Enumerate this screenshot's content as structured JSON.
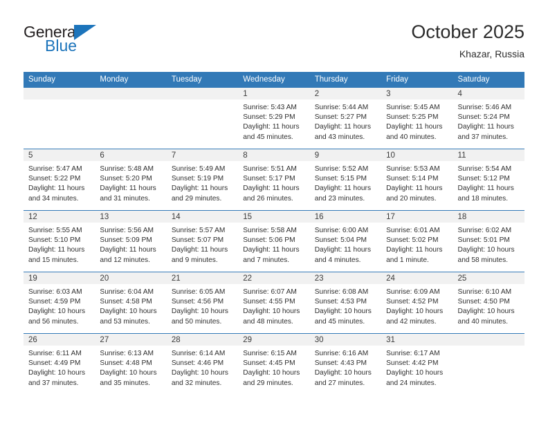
{
  "brand": {
    "name_top": "General",
    "name_bottom": "Blue",
    "triangle_icon": "blue-triangle-icon",
    "color_dark": "#231f20",
    "color_blue": "#1c74bb"
  },
  "header": {
    "title": "October 2025",
    "subtitle": "Khazar, Russia"
  },
  "theme": {
    "header_blue": "#3279b7",
    "daynum_band": "#f1f1f1",
    "text": "#2e2e2e"
  },
  "weekdays": [
    "Sunday",
    "Monday",
    "Tuesday",
    "Wednesday",
    "Thursday",
    "Friday",
    "Saturday"
  ],
  "weeks": [
    [
      {
        "day": "",
        "empty": true,
        "lines": []
      },
      {
        "day": "",
        "empty": true,
        "lines": []
      },
      {
        "day": "",
        "empty": true,
        "lines": []
      },
      {
        "day": "1",
        "empty": false,
        "lines": [
          "Sunrise: 5:43 AM",
          "Sunset: 5:29 PM",
          "Daylight: 11 hours",
          "and 45 minutes."
        ]
      },
      {
        "day": "2",
        "empty": false,
        "lines": [
          "Sunrise: 5:44 AM",
          "Sunset: 5:27 PM",
          "Daylight: 11 hours",
          "and 43 minutes."
        ]
      },
      {
        "day": "3",
        "empty": false,
        "lines": [
          "Sunrise: 5:45 AM",
          "Sunset: 5:25 PM",
          "Daylight: 11 hours",
          "and 40 minutes."
        ]
      },
      {
        "day": "4",
        "empty": false,
        "lines": [
          "Sunrise: 5:46 AM",
          "Sunset: 5:24 PM",
          "Daylight: 11 hours",
          "and 37 minutes."
        ]
      }
    ],
    [
      {
        "day": "5",
        "empty": false,
        "lines": [
          "Sunrise: 5:47 AM",
          "Sunset: 5:22 PM",
          "Daylight: 11 hours",
          "and 34 minutes."
        ]
      },
      {
        "day": "6",
        "empty": false,
        "lines": [
          "Sunrise: 5:48 AM",
          "Sunset: 5:20 PM",
          "Daylight: 11 hours",
          "and 31 minutes."
        ]
      },
      {
        "day": "7",
        "empty": false,
        "lines": [
          "Sunrise: 5:49 AM",
          "Sunset: 5:19 PM",
          "Daylight: 11 hours",
          "and 29 minutes."
        ]
      },
      {
        "day": "8",
        "empty": false,
        "lines": [
          "Sunrise: 5:51 AM",
          "Sunset: 5:17 PM",
          "Daylight: 11 hours",
          "and 26 minutes."
        ]
      },
      {
        "day": "9",
        "empty": false,
        "lines": [
          "Sunrise: 5:52 AM",
          "Sunset: 5:15 PM",
          "Daylight: 11 hours",
          "and 23 minutes."
        ]
      },
      {
        "day": "10",
        "empty": false,
        "lines": [
          "Sunrise: 5:53 AM",
          "Sunset: 5:14 PM",
          "Daylight: 11 hours",
          "and 20 minutes."
        ]
      },
      {
        "day": "11",
        "empty": false,
        "lines": [
          "Sunrise: 5:54 AM",
          "Sunset: 5:12 PM",
          "Daylight: 11 hours",
          "and 18 minutes."
        ]
      }
    ],
    [
      {
        "day": "12",
        "empty": false,
        "lines": [
          "Sunrise: 5:55 AM",
          "Sunset: 5:10 PM",
          "Daylight: 11 hours",
          "and 15 minutes."
        ]
      },
      {
        "day": "13",
        "empty": false,
        "lines": [
          "Sunrise: 5:56 AM",
          "Sunset: 5:09 PM",
          "Daylight: 11 hours",
          "and 12 minutes."
        ]
      },
      {
        "day": "14",
        "empty": false,
        "lines": [
          "Sunrise: 5:57 AM",
          "Sunset: 5:07 PM",
          "Daylight: 11 hours",
          "and 9 minutes."
        ]
      },
      {
        "day": "15",
        "empty": false,
        "lines": [
          "Sunrise: 5:58 AM",
          "Sunset: 5:06 PM",
          "Daylight: 11 hours",
          "and 7 minutes."
        ]
      },
      {
        "day": "16",
        "empty": false,
        "lines": [
          "Sunrise: 6:00 AM",
          "Sunset: 5:04 PM",
          "Daylight: 11 hours",
          "and 4 minutes."
        ]
      },
      {
        "day": "17",
        "empty": false,
        "lines": [
          "Sunrise: 6:01 AM",
          "Sunset: 5:02 PM",
          "Daylight: 11 hours",
          "and 1 minute."
        ]
      },
      {
        "day": "18",
        "empty": false,
        "lines": [
          "Sunrise: 6:02 AM",
          "Sunset: 5:01 PM",
          "Daylight: 10 hours",
          "and 58 minutes."
        ]
      }
    ],
    [
      {
        "day": "19",
        "empty": false,
        "lines": [
          "Sunrise: 6:03 AM",
          "Sunset: 4:59 PM",
          "Daylight: 10 hours",
          "and 56 minutes."
        ]
      },
      {
        "day": "20",
        "empty": false,
        "lines": [
          "Sunrise: 6:04 AM",
          "Sunset: 4:58 PM",
          "Daylight: 10 hours",
          "and 53 minutes."
        ]
      },
      {
        "day": "21",
        "empty": false,
        "lines": [
          "Sunrise: 6:05 AM",
          "Sunset: 4:56 PM",
          "Daylight: 10 hours",
          "and 50 minutes."
        ]
      },
      {
        "day": "22",
        "empty": false,
        "lines": [
          "Sunrise: 6:07 AM",
          "Sunset: 4:55 PM",
          "Daylight: 10 hours",
          "and 48 minutes."
        ]
      },
      {
        "day": "23",
        "empty": false,
        "lines": [
          "Sunrise: 6:08 AM",
          "Sunset: 4:53 PM",
          "Daylight: 10 hours",
          "and 45 minutes."
        ]
      },
      {
        "day": "24",
        "empty": false,
        "lines": [
          "Sunrise: 6:09 AM",
          "Sunset: 4:52 PM",
          "Daylight: 10 hours",
          "and 42 minutes."
        ]
      },
      {
        "day": "25",
        "empty": false,
        "lines": [
          "Sunrise: 6:10 AM",
          "Sunset: 4:50 PM",
          "Daylight: 10 hours",
          "and 40 minutes."
        ]
      }
    ],
    [
      {
        "day": "26",
        "empty": false,
        "lines": [
          "Sunrise: 6:11 AM",
          "Sunset: 4:49 PM",
          "Daylight: 10 hours",
          "and 37 minutes."
        ]
      },
      {
        "day": "27",
        "empty": false,
        "lines": [
          "Sunrise: 6:13 AM",
          "Sunset: 4:48 PM",
          "Daylight: 10 hours",
          "and 35 minutes."
        ]
      },
      {
        "day": "28",
        "empty": false,
        "lines": [
          "Sunrise: 6:14 AM",
          "Sunset: 4:46 PM",
          "Daylight: 10 hours",
          "and 32 minutes."
        ]
      },
      {
        "day": "29",
        "empty": false,
        "lines": [
          "Sunrise: 6:15 AM",
          "Sunset: 4:45 PM",
          "Daylight: 10 hours",
          "and 29 minutes."
        ]
      },
      {
        "day": "30",
        "empty": false,
        "lines": [
          "Sunrise: 6:16 AM",
          "Sunset: 4:43 PM",
          "Daylight: 10 hours",
          "and 27 minutes."
        ]
      },
      {
        "day": "31",
        "empty": false,
        "lines": [
          "Sunrise: 6:17 AM",
          "Sunset: 4:42 PM",
          "Daylight: 10 hours",
          "and 24 minutes."
        ]
      },
      {
        "day": "",
        "empty": true,
        "lines": []
      }
    ]
  ]
}
